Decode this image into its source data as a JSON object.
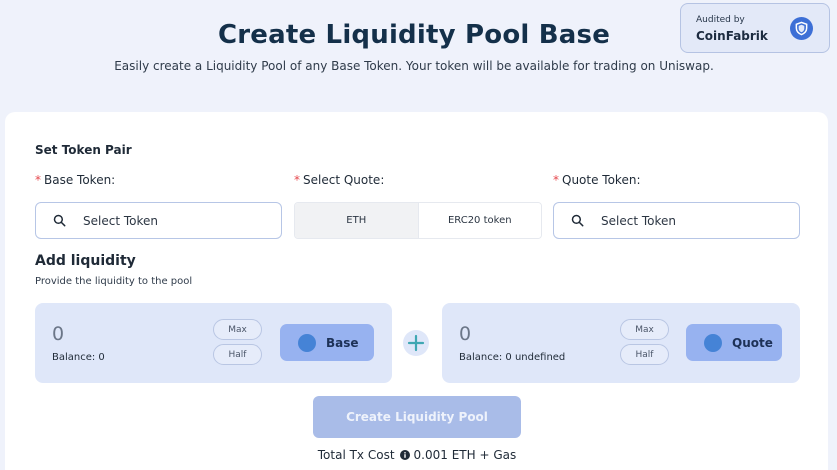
{
  "header": {
    "title": "Create Liquidity Pool Base",
    "subtitle": "Easily create a Liquidity Pool of any Base Token. Your token will be available for trading on Uniswap."
  },
  "audit": {
    "label": "Audited by",
    "name": "CoinFabrik",
    "icon": "shield-icon"
  },
  "token_pair": {
    "section_label": "Set Token Pair",
    "required_mark": "*",
    "base_label": "Base Token:",
    "quote_select_label": "Select Quote:",
    "quote_label": "Quote Token:",
    "base_placeholder": "Select Token",
    "quote_placeholder": "Select Token",
    "quote_options": [
      "ETH",
      "ERC20 token"
    ]
  },
  "liquidity": {
    "title": "Add liquidity",
    "subtitle": "Provide the liquidity to the pool",
    "base": {
      "amount": "0",
      "balance": "Balance: 0",
      "max": "Max",
      "half": "Half",
      "token": "Base"
    },
    "quote": {
      "amount": "0",
      "balance": "Balance: 0 undefined",
      "max": "Max",
      "half": "Half",
      "token": "Quote"
    }
  },
  "action": {
    "create_label": "Create Liquidity Pool",
    "tx_cost_label": "Total Tx Cost",
    "tx_cost_value": "0.001 ETH + Gas"
  },
  "colors": {
    "accent": "#3d6fd6",
    "panel": "#dfe7f9",
    "token_button": "#97b2f0",
    "create_button_disabled": "#a9bce8",
    "required": "#e5484d"
  }
}
